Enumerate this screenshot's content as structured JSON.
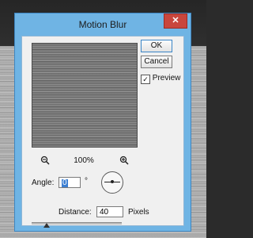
{
  "window": {
    "title": "Motion Blur",
    "close_glyph": "✕"
  },
  "buttons": {
    "ok": "OK",
    "cancel": "Cancel"
  },
  "preview": {
    "label": "Preview",
    "checked": true,
    "check_glyph": "✓"
  },
  "zoom": {
    "level": "100%",
    "zoom_out_icon": "zoom-out-icon",
    "zoom_in_icon": "zoom-in-icon"
  },
  "angle": {
    "label": "Angle:",
    "value": "0",
    "unit": "°"
  },
  "distance": {
    "label": "Distance:",
    "value": "40",
    "unit": "Pixels",
    "slider_fraction": 0.04
  },
  "colors": {
    "titlebar": "#6fb4e4",
    "close": "#c9463d",
    "selection": "#3c7fd2"
  }
}
